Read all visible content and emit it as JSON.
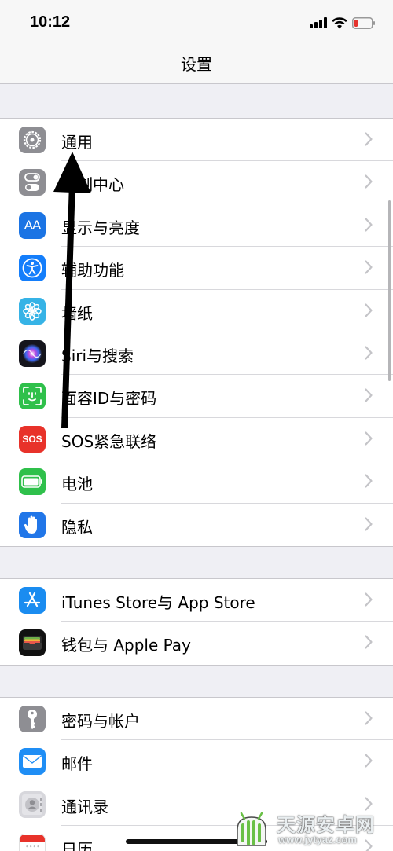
{
  "status_bar": {
    "time": "10:12"
  },
  "nav": {
    "title": "设置"
  },
  "groups": [
    {
      "items": [
        {
          "label": "通用",
          "icon": "gear-icon"
        },
        {
          "label": "控制中心",
          "icon": "toggle-icon"
        },
        {
          "label": "显示与亮度",
          "icon": "text-size-icon",
          "icon_text": "AA"
        },
        {
          "label": "辅助功能",
          "icon": "accessibility-icon"
        },
        {
          "label": "墙纸",
          "icon": "flower-icon"
        },
        {
          "label": "Siri与搜索",
          "icon": "siri-icon"
        },
        {
          "label": "面容ID与密码",
          "icon": "face-id-icon"
        },
        {
          "label": "SOS紧急联络",
          "icon": "sos-icon",
          "icon_text": "SOS"
        },
        {
          "label": "电池",
          "icon": "battery-icon"
        },
        {
          "label": "隐私",
          "icon": "hand-icon"
        }
      ]
    },
    {
      "items": [
        {
          "label": "iTunes Store与 App Store",
          "icon": "app-store-icon"
        },
        {
          "label": "钱包与 Apple Pay",
          "icon": "wallet-icon"
        }
      ]
    },
    {
      "items": [
        {
          "label": "密码与帐户",
          "icon": "key-icon"
        },
        {
          "label": "邮件",
          "icon": "mail-icon"
        },
        {
          "label": "通讯录",
          "icon": "contacts-icon"
        },
        {
          "label": "日历",
          "icon": "calendar-icon"
        }
      ]
    }
  ],
  "watermark": {
    "text": "天源安卓网",
    "url": "www.jytyaz.com"
  },
  "colors": {
    "gear": "#8e8e93",
    "toggle": "#8e8e93",
    "display": "#1b74e4",
    "accessibility": "#147efb",
    "wallpaper": "#36b3e6",
    "sos": "#e8322a",
    "face_id": "#2fc04b",
    "battery": "#2fc04b",
    "privacy": "#2176e8",
    "app_store": "#1a8cf0",
    "wallet": "#111111",
    "key": "#8e8e93",
    "mail": "#1f8ef5",
    "contacts": "#d7d7dc",
    "calendar": "#ffffff"
  }
}
